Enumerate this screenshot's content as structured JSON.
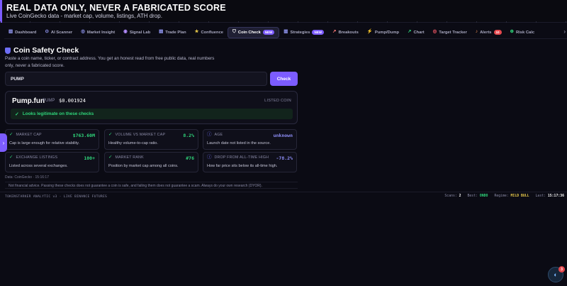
{
  "banner": {
    "title": "REAL DATA ONLY, NEVER A FABRICATED SCORE",
    "subtitle": "Live CoinGecko data - market cap, volume, listings, ATH drop."
  },
  "nav": {
    "items": [
      {
        "label": "Dashboard",
        "icon": "dashboard-icon",
        "glyph": "▥",
        "color": "#9aa0ff"
      },
      {
        "label": "AI Scanner",
        "icon": "ai-scanner-icon",
        "glyph": "⊙",
        "color": "#9aa0ff"
      },
      {
        "label": "Market Insight",
        "icon": "market-insight-icon",
        "glyph": "◎",
        "color": "#9aa0ff"
      },
      {
        "label": "Signal Lab",
        "icon": "signal-lab-icon",
        "glyph": "◉",
        "color": "#b48cff"
      },
      {
        "label": "Trade Plan",
        "icon": "trade-plan-icon",
        "glyph": "▤",
        "color": "#9aa0ff"
      },
      {
        "label": "Confluence",
        "icon": "confluence-icon",
        "glyph": "★",
        "color": "#e6c84a"
      },
      {
        "label": "Coin Check",
        "icon": "shield-icon",
        "glyph": "⛉",
        "color": "#ffffff",
        "badge": "NEW",
        "active": true
      },
      {
        "label": "Strategies",
        "icon": "strategies-icon",
        "glyph": "▥",
        "color": "#9aa0ff",
        "badge": "NEW"
      },
      {
        "label": "Breakouts",
        "icon": "breakouts-icon",
        "glyph": "↗",
        "color": "#ff7a7a"
      },
      {
        "label": "Pump/Dump",
        "icon": "pump-dump-icon",
        "glyph": "⚡",
        "color": "#e6c84a"
      },
      {
        "label": "Chart",
        "icon": "chart-icon",
        "glyph": "↗",
        "color": "#2fd47a"
      },
      {
        "label": "Target Tracker",
        "icon": "target-icon",
        "glyph": "◎",
        "color": "#ff5a6a"
      },
      {
        "label": "Alerts",
        "icon": "bell-icon",
        "glyph": "♪",
        "color": "#ff9a5a",
        "count": "10"
      },
      {
        "label": "Risk Calc",
        "icon": "risk-calc-icon",
        "glyph": "⊕",
        "color": "#2fd47a"
      }
    ],
    "more_arrow": "›"
  },
  "page": {
    "title": "Coin Safety Check",
    "description": "Paste a coin name, ticker, or contract address. You get an honest read from free public data, real numbers only, never a fabricated score.",
    "search_value": "PUMP",
    "check_label": "Check"
  },
  "result": {
    "name": "Pump.fun",
    "ticker": "PUMP",
    "price": "$0.001924",
    "status": "LISTED COIN",
    "verdict": "Looks legitimate on these checks"
  },
  "metrics": [
    {
      "label": "MARKET CAP",
      "value": "$763.60M",
      "desc": "Cap is large enough for relative stability.",
      "icon": "check-icon",
      "kind": "ok"
    },
    {
      "label": "VOLUME VS MARKET CAP",
      "value": "8.2%",
      "desc": "Healthy volume-to-cap ratio.",
      "icon": "check-icon",
      "kind": "ok"
    },
    {
      "label": "AGE",
      "value": "unknown",
      "desc": "Launch date not listed in the source.",
      "icon": "info-icon",
      "kind": "info"
    },
    {
      "label": "EXCHANGE LISTINGS",
      "value": "100+",
      "desc": "Listed across several exchanges.",
      "icon": "check-icon",
      "kind": "ok"
    },
    {
      "label": "MARKET RANK",
      "value": "#76",
      "desc": "Position by market cap among all coins.",
      "icon": "check-icon",
      "kind": "ok"
    },
    {
      "label": "DROP FROM ALL-TIME HIGH",
      "value": "-78.2%",
      "desc": "How far price sits below its all-time high.",
      "icon": "info-icon",
      "kind": "info"
    }
  ],
  "source": "Data: CoinGecko · 15:16:17",
  "disclaimer": "Not financial advice. Passing these checks does not guarantee a coin is safe, and failing them does not guarantee a scam. Always do your own research (DYOR).",
  "footer": {
    "left": "TOKENSTARKER ANALYTIC v3 · LIVE BINANCE FUTURES",
    "scans_label": "Scans:",
    "scans_value": "2",
    "best_label": "Best:",
    "best_value": "ONDO",
    "regime_label": "Regime:",
    "regime_value": "MILD BULL",
    "last_label": "Last:",
    "last_value": "15:17:36"
  },
  "side_tab_glyph": "›",
  "fab": {
    "icon": "chat-icon",
    "glyph": "◐",
    "badge": "3"
  },
  "colors": {
    "accent": "#7c5cff",
    "good": "#2fd47a",
    "info": "#8f8ff8",
    "alert": "#e5484d"
  }
}
